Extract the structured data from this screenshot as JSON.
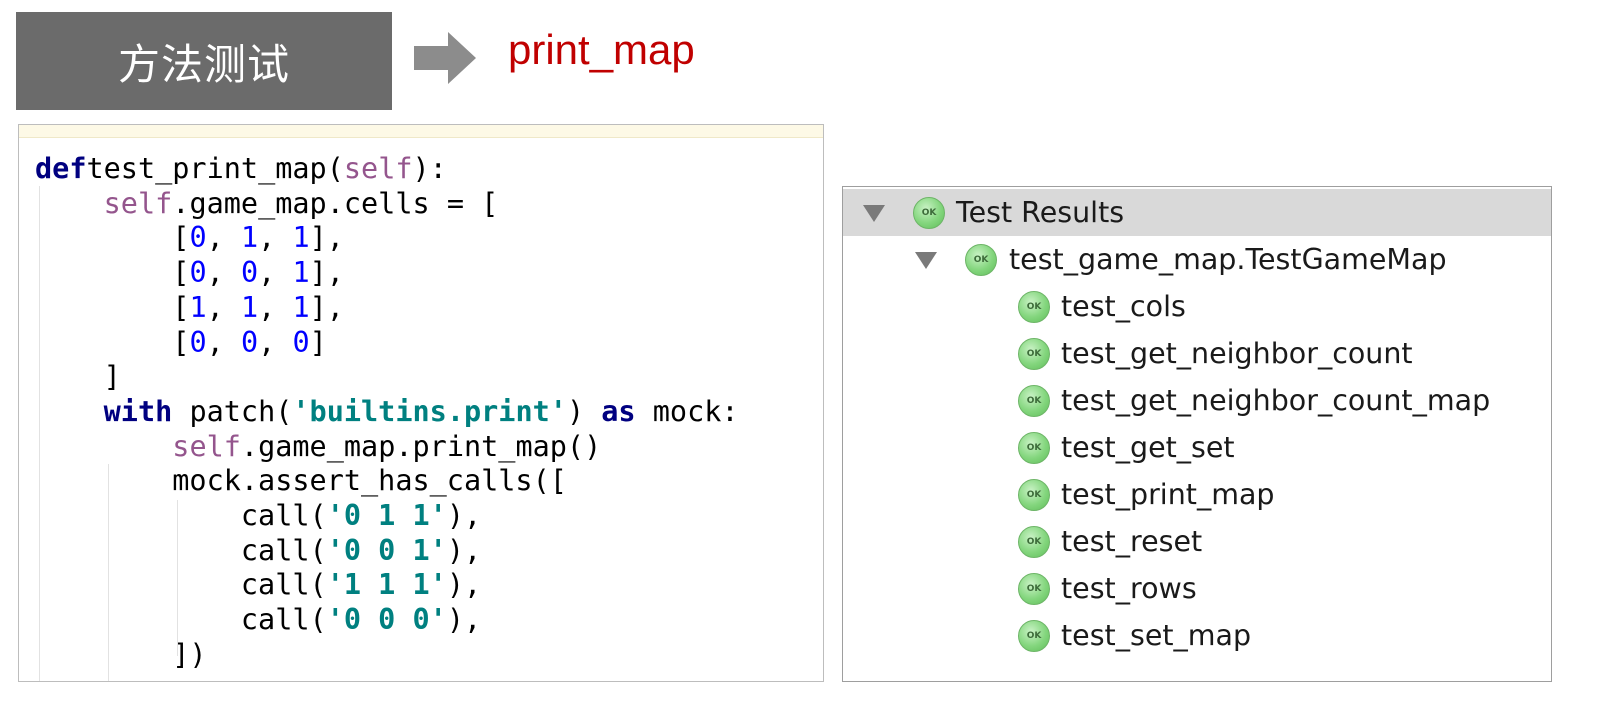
{
  "slide": {
    "section_title": "方法测试",
    "method_name": "print_map"
  },
  "code": {
    "lines": [
      [
        [
          "kw",
          "def"
        ],
        [
          "",
          "test_print_map("
        ],
        [
          "slf",
          "self"
        ],
        [
          "",
          "):"
        ]
      ],
      [
        [
          "",
          "    "
        ],
        [
          "slf",
          "self"
        ],
        [
          "",
          ".game_map.cells = ["
        ]
      ],
      [
        [
          "",
          "        ["
        ],
        [
          "num",
          "0"
        ],
        [
          "",
          ", "
        ],
        [
          "num",
          "1"
        ],
        [
          "",
          ", "
        ],
        [
          "num",
          "1"
        ],
        [
          "",
          "],"
        ]
      ],
      [
        [
          "",
          "        ["
        ],
        [
          "num",
          "0"
        ],
        [
          "",
          ", "
        ],
        [
          "num",
          "0"
        ],
        [
          "",
          ", "
        ],
        [
          "num",
          "1"
        ],
        [
          "",
          "],"
        ]
      ],
      [
        [
          "",
          "        ["
        ],
        [
          "num",
          "1"
        ],
        [
          "",
          ", "
        ],
        [
          "num",
          "1"
        ],
        [
          "",
          ", "
        ],
        [
          "num",
          "1"
        ],
        [
          "",
          "],"
        ]
      ],
      [
        [
          "",
          "        ["
        ],
        [
          "num",
          "0"
        ],
        [
          "",
          ", "
        ],
        [
          "num",
          "0"
        ],
        [
          "",
          ", "
        ],
        [
          "num",
          "0"
        ],
        [
          "",
          "]"
        ]
      ],
      [
        [
          "",
          "    ]"
        ]
      ],
      [
        [
          "",
          "    "
        ],
        [
          "kw",
          "with"
        ],
        [
          "",
          " patch("
        ],
        [
          "str",
          "'builtins.print'"
        ],
        [
          "",
          ") "
        ],
        [
          "kw",
          "as"
        ],
        [
          "",
          " mock:"
        ]
      ],
      [
        [
          "",
          "        "
        ],
        [
          "slf",
          "self"
        ],
        [
          "",
          ".game_map.print_map()"
        ]
      ],
      [
        [
          "",
          "        mock.assert_has_calls(["
        ]
      ],
      [
        [
          "",
          "            call("
        ],
        [
          "str",
          "'0 1 1'"
        ],
        [
          "",
          "),"
        ]
      ],
      [
        [
          "",
          "            call("
        ],
        [
          "str",
          "'0 0 1'"
        ],
        [
          "",
          "),"
        ]
      ],
      [
        [
          "",
          "            call("
        ],
        [
          "str",
          "'1 1 1'"
        ],
        [
          "",
          "),"
        ]
      ],
      [
        [
          "",
          "            call("
        ],
        [
          "str",
          "'0 0 0'"
        ],
        [
          "",
          "),"
        ]
      ],
      [
        [
          "",
          "        ])"
        ]
      ]
    ]
  },
  "test_results": {
    "root": {
      "label": "Test Results",
      "status": "OK",
      "expanded": true
    },
    "suite": {
      "label": "test_game_map.TestGameMap",
      "status": "OK",
      "expanded": true
    },
    "tests": [
      {
        "label": "test_cols",
        "status": "OK"
      },
      {
        "label": "test_get_neighbor_count",
        "status": "OK"
      },
      {
        "label": "test_get_neighbor_count_map",
        "status": "OK"
      },
      {
        "label": "test_get_set",
        "status": "OK"
      },
      {
        "label": "test_print_map",
        "status": "OK"
      },
      {
        "label": "test_reset",
        "status": "OK"
      },
      {
        "label": "test_rows",
        "status": "OK"
      },
      {
        "label": "test_set_map",
        "status": "OK"
      }
    ]
  },
  "icons": {
    "arrow": "right-arrow-icon",
    "ok": "ok-status-icon",
    "expand": "expand-triangle-icon"
  },
  "colors": {
    "title_box": "#6b6b6b",
    "method_name": "#c00000",
    "ok_green": "#84d67e",
    "keyword": "#000080",
    "self": "#94558d",
    "number": "#0000ff",
    "string": "#008080"
  }
}
